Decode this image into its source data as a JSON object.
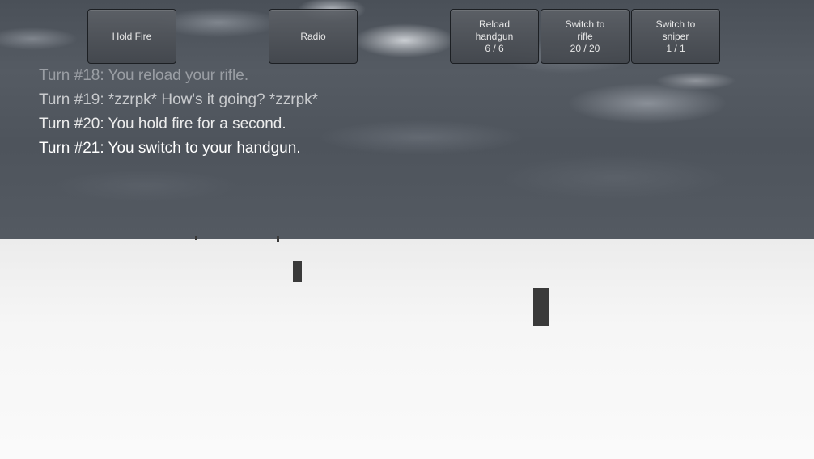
{
  "hud": {
    "buttons": [
      {
        "name": "hold-fire-button",
        "lines": [
          "Hold Fire"
        ]
      },
      {
        "name": "radio-button",
        "lines": [
          "Radio"
        ]
      },
      {
        "name": "reload-handgun-button",
        "lines": [
          "Reload",
          "handgun",
          "6 / 6"
        ]
      },
      {
        "name": "switch-to-rifle-button",
        "lines": [
          "Switch to",
          "rifle",
          "20 / 20"
        ]
      },
      {
        "name": "switch-to-sniper-button",
        "lines": [
          "Switch to",
          "sniper",
          "1 / 1"
        ]
      }
    ]
  },
  "log": {
    "lines": [
      {
        "text": "Turn #18: You reload your rifle.",
        "color": "#9a9ea4"
      },
      {
        "text": "Turn #19: *zzrpk* How's it going? *zzrpk*",
        "color": "#c8cacd"
      },
      {
        "text": "Turn #20: You hold fire for a second.",
        "color": "#ececec"
      },
      {
        "text": "Turn #21: You switch to your handgun.",
        "color": "#ffffff"
      }
    ]
  },
  "colors": {
    "sky": "#50565e",
    "ground": "#f4f4f4",
    "target": "#3a3a3a",
    "button_bg": "#54585e"
  }
}
